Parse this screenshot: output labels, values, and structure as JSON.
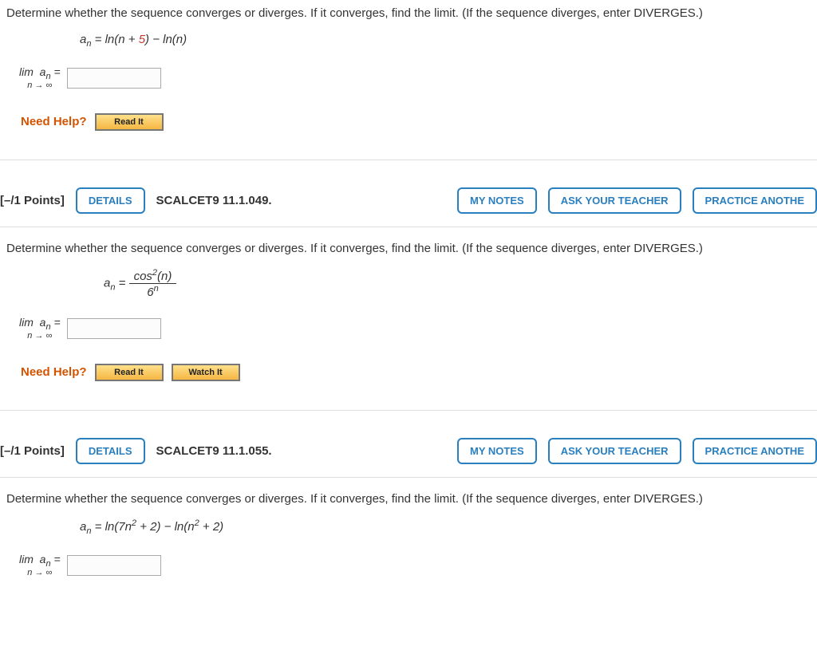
{
  "q1": {
    "prompt": "Determine whether the sequence converges or diverges. If it converges, find the limit. (If the sequence diverges, enter DIVERGES.)",
    "formula_prefix": "a",
    "formula_sub": "n",
    "eq": " = ln(",
    "n1": "n",
    "plus": " + ",
    "five": "5",
    "mid": ") − ln(",
    "n2": "n",
    "end": ")",
    "lim_top": "lim",
    "lim_bot": "n → ∞",
    "lim_an_a": "a",
    "lim_an_n": "n",
    "lim_eq": " =",
    "need_help": "Need Help?",
    "read_it": "Read It"
  },
  "q2": {
    "points": "[–/1 Points]",
    "details": "DETAILS",
    "ref": "SCALCET9 11.1.049.",
    "my_notes": "MY NOTES",
    "ask": "ASK YOUR TEACHER",
    "practice": "PRACTICE ANOTHE",
    "prompt": "Determine whether the sequence converges or diverges. If it converges, find the limit. (If the sequence diverges, enter DIVERGES.)",
    "a": "a",
    "n": "n",
    "eq": " = ",
    "num_cos": "cos",
    "num_sup": "2",
    "num_paren": "(",
    "num_n": "n",
    "num_close": ")",
    "den_base": "6",
    "den_sup": "n",
    "lim_top": "lim",
    "lim_bot": "n → ∞",
    "lim_an_a": "a",
    "lim_an_n": "n",
    "lim_eq": " =",
    "need_help": "Need Help?",
    "read_it": "Read It",
    "watch_it": "Watch It"
  },
  "q3": {
    "points": "[–/1 Points]",
    "details": "DETAILS",
    "ref": "SCALCET9 11.1.055.",
    "my_notes": "MY NOTES",
    "ask": "ASK YOUR TEACHER",
    "practice": "PRACTICE ANOTHE",
    "prompt": "Determine whether the sequence converges or diverges. If it converges, find the limit. (If the sequence diverges, enter DIVERGES.)",
    "a": "a",
    "n": "n",
    "eq": " = ln(7",
    "n2": "n",
    "sup2a": "2",
    "plus2a": " + 2) − ln(",
    "n2b": "n",
    "sup2b": "2",
    "end": " + 2)",
    "lim_top": "lim",
    "lim_bot": "n → ∞",
    "lim_an_a": "a",
    "lim_an_n": "n",
    "lim_eq": " ="
  }
}
